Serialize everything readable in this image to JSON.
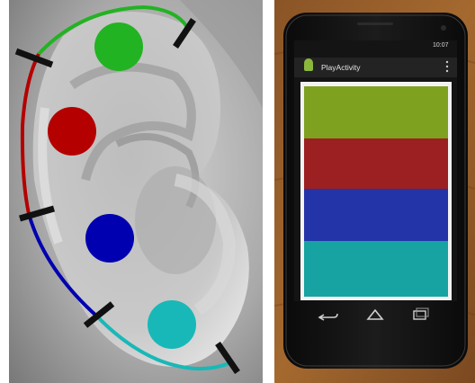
{
  "left_figure": {
    "regions": [
      {
        "name": "upper-helix",
        "color": "#22b322"
      },
      {
        "name": "mid-helix",
        "color": "#b50000"
      },
      {
        "name": "lower-helix",
        "color": "#0000b0"
      },
      {
        "name": "lobe",
        "color": "#18b8b8"
      }
    ],
    "divider_color": "#111111"
  },
  "phone": {
    "status_time": "10:07",
    "app_title": "PlayActivity",
    "stripes": [
      "#7ea11f",
      "#9c1f22",
      "#2333a8",
      "#16a3a1"
    ],
    "nav_icons": [
      "back-icon",
      "home-icon",
      "recents-icon"
    ]
  }
}
